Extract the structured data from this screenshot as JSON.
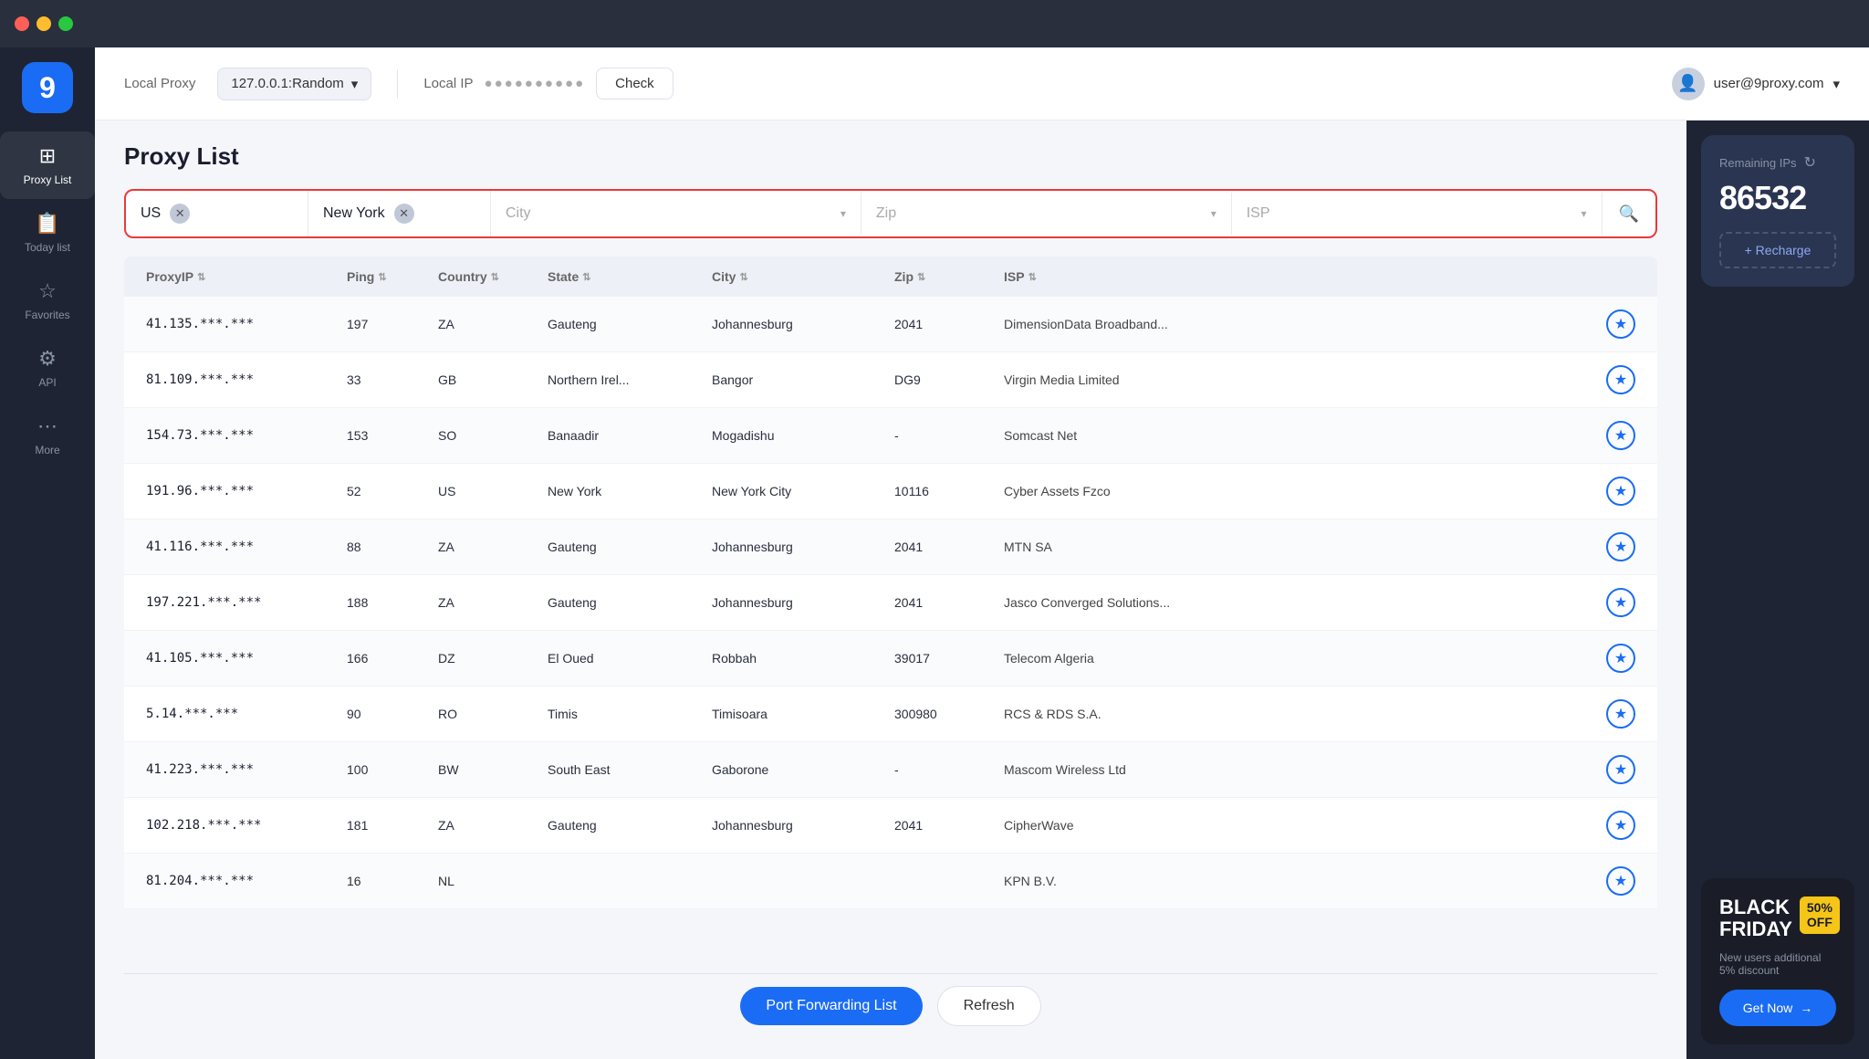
{
  "titlebar": {
    "lights": [
      "red",
      "yellow",
      "green"
    ]
  },
  "sidebar": {
    "logo": "9",
    "items": [
      {
        "id": "proxy-list",
        "label": "Proxy List",
        "icon": "⊞",
        "active": true
      },
      {
        "id": "today-list",
        "label": "Today list",
        "icon": "📋",
        "active": false
      },
      {
        "id": "favorites",
        "label": "Favorites",
        "icon": "☆",
        "active": false
      },
      {
        "id": "api",
        "label": "API",
        "icon": "⚙",
        "active": false
      },
      {
        "id": "more",
        "label": "More",
        "icon": "⋯",
        "active": false
      }
    ]
  },
  "header": {
    "local_proxy_label": "Local Proxy",
    "proxy_value": "127.0.0.1:Random",
    "local_ip_label": "Local IP",
    "ip_masked": "●●●●●●●●●●",
    "check_btn": "Check",
    "user": "user@9proxy.com"
  },
  "page": {
    "title": "Proxy List"
  },
  "filter": {
    "country": "US",
    "state": "New York",
    "city_placeholder": "City",
    "zip_placeholder": "Zip",
    "isp_placeholder": "ISP"
  },
  "table": {
    "columns": [
      {
        "label": "ProxyIP",
        "key": "proxyip"
      },
      {
        "label": "Ping",
        "key": "ping"
      },
      {
        "label": "Country",
        "key": "country"
      },
      {
        "label": "State",
        "key": "state"
      },
      {
        "label": "City",
        "key": "city"
      },
      {
        "label": "Zip",
        "key": "zip"
      },
      {
        "label": "ISP",
        "key": "isp"
      }
    ],
    "rows": [
      {
        "proxyip": "41.135.***.***",
        "ping": "197",
        "country": "ZA",
        "state": "Gauteng",
        "city": "Johannesburg",
        "zip": "2041",
        "isp": "DimensionData Broadband..."
      },
      {
        "proxyip": "81.109.***.***",
        "ping": "33",
        "country": "GB",
        "state": "Northern Irel...",
        "city": "Bangor",
        "zip": "DG9",
        "isp": "Virgin Media Limited"
      },
      {
        "proxyip": "154.73.***.***",
        "ping": "153",
        "country": "SO",
        "state": "Banaadir",
        "city": "Mogadishu",
        "zip": "-",
        "isp": "Somcast Net"
      },
      {
        "proxyip": "191.96.***.***",
        "ping": "52",
        "country": "US",
        "state": "New York",
        "city": "New York City",
        "zip": "10116",
        "isp": "Cyber Assets Fzco"
      },
      {
        "proxyip": "41.116.***.***",
        "ping": "88",
        "country": "ZA",
        "state": "Gauteng",
        "city": "Johannesburg",
        "zip": "2041",
        "isp": "MTN SA"
      },
      {
        "proxyip": "197.221.***.***",
        "ping": "188",
        "country": "ZA",
        "state": "Gauteng",
        "city": "Johannesburg",
        "zip": "2041",
        "isp": "Jasco Converged Solutions..."
      },
      {
        "proxyip": "41.105.***.***",
        "ping": "166",
        "country": "DZ",
        "state": "El Oued",
        "city": "Robbah",
        "zip": "39017",
        "isp": "Telecom Algeria"
      },
      {
        "proxyip": "5.14.***.***",
        "ping": "90",
        "country": "RO",
        "state": "Timis",
        "city": "Timisoara",
        "zip": "300980",
        "isp": "RCS & RDS S.A."
      },
      {
        "proxyip": "41.223.***.***",
        "ping": "100",
        "country": "BW",
        "state": "South East",
        "city": "Gaborone",
        "zip": "-",
        "isp": "Mascom Wireless Ltd"
      },
      {
        "proxyip": "102.218.***.***",
        "ping": "181",
        "country": "ZA",
        "state": "Gauteng",
        "city": "Johannesburg",
        "zip": "2041",
        "isp": "CipherWave"
      },
      {
        "proxyip": "81.204.***.***",
        "ping": "16",
        "country": "NL",
        "state": "",
        "city": "",
        "zip": "",
        "isp": "KPN B.V."
      }
    ]
  },
  "bottom": {
    "port_forwarding_btn": "Port Forwarding List",
    "refresh_btn": "Refresh"
  },
  "right_panel": {
    "remaining_label": "Remaining IPs",
    "remaining_count": "86532",
    "recharge_btn": "+ Recharge",
    "bf_title": "BLACK\nFRIDAY",
    "bf_badge": "50%\nOFF",
    "bf_desc": "New users additional\n5% discount",
    "get_now_btn": "Get Now"
  }
}
